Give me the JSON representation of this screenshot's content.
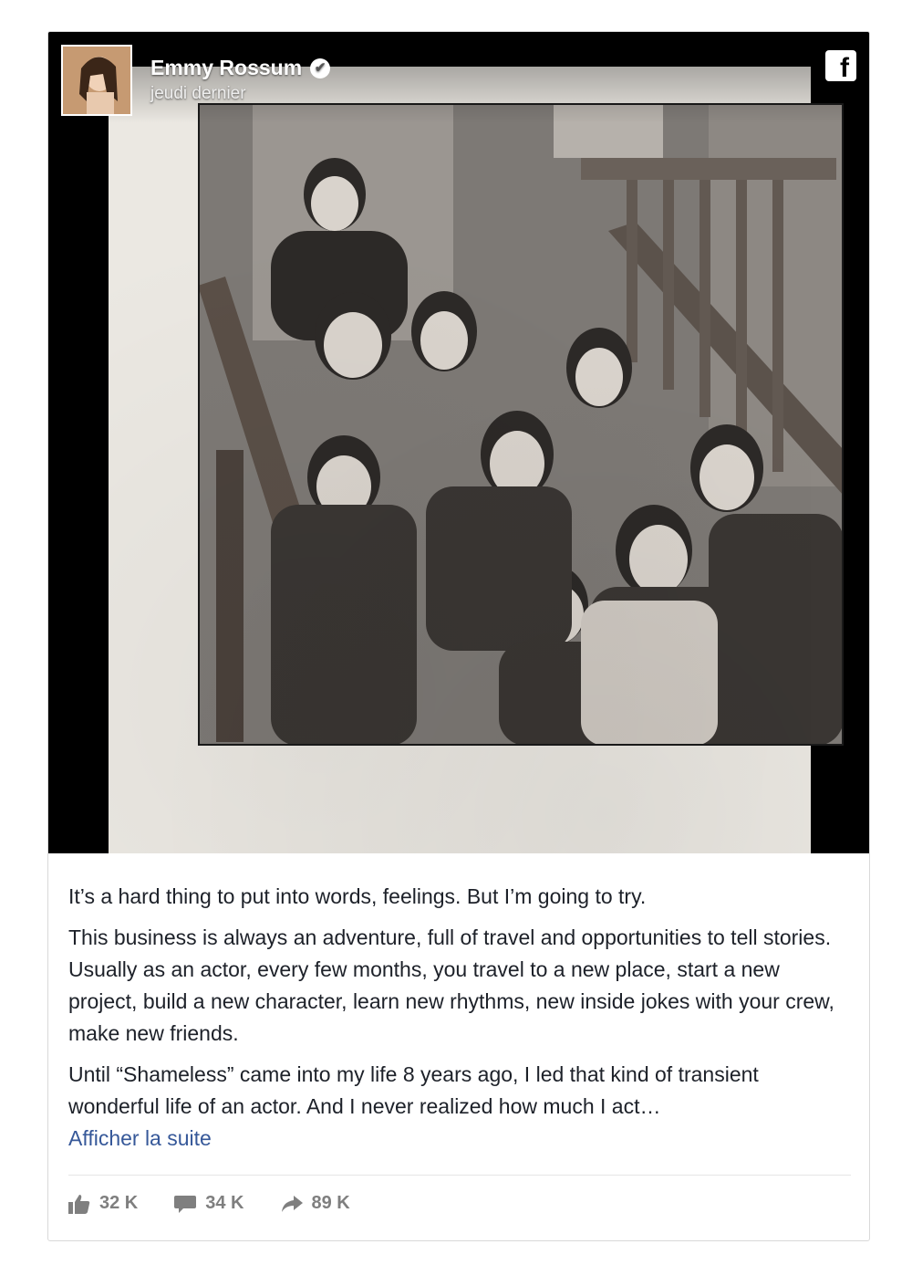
{
  "post": {
    "author": "Emmy Rossum",
    "date": "jeudi dernier",
    "paragraphs": [
      "It’s a hard thing to put into words, feelings. But I’m going to try.",
      "This business is always an adventure, full of travel and opportunities to tell stories. Usually as an actor, every few months, you travel to a new place, start a new project, build a new character, learn new rhythms, new inside jokes with your crew, make new friends.",
      "Until “Shameless” came into my life 8 years ago, I led that kind of transient wonderful life of an actor. And I never realized how much I act…"
    ],
    "see_more": "Afficher la suite"
  },
  "stats": {
    "likes": "32 K",
    "comments": "34 K",
    "shares": "89 K"
  },
  "icons": {
    "verified": "check-badge-icon",
    "facebook": "facebook-logo-icon",
    "like": "thumbs-up-icon",
    "comment": "speech-bubble-icon",
    "share": "share-arrow-icon"
  },
  "colors": {
    "link": "#365899",
    "text": "#1d2129",
    "stats": "#7f7f7f"
  }
}
